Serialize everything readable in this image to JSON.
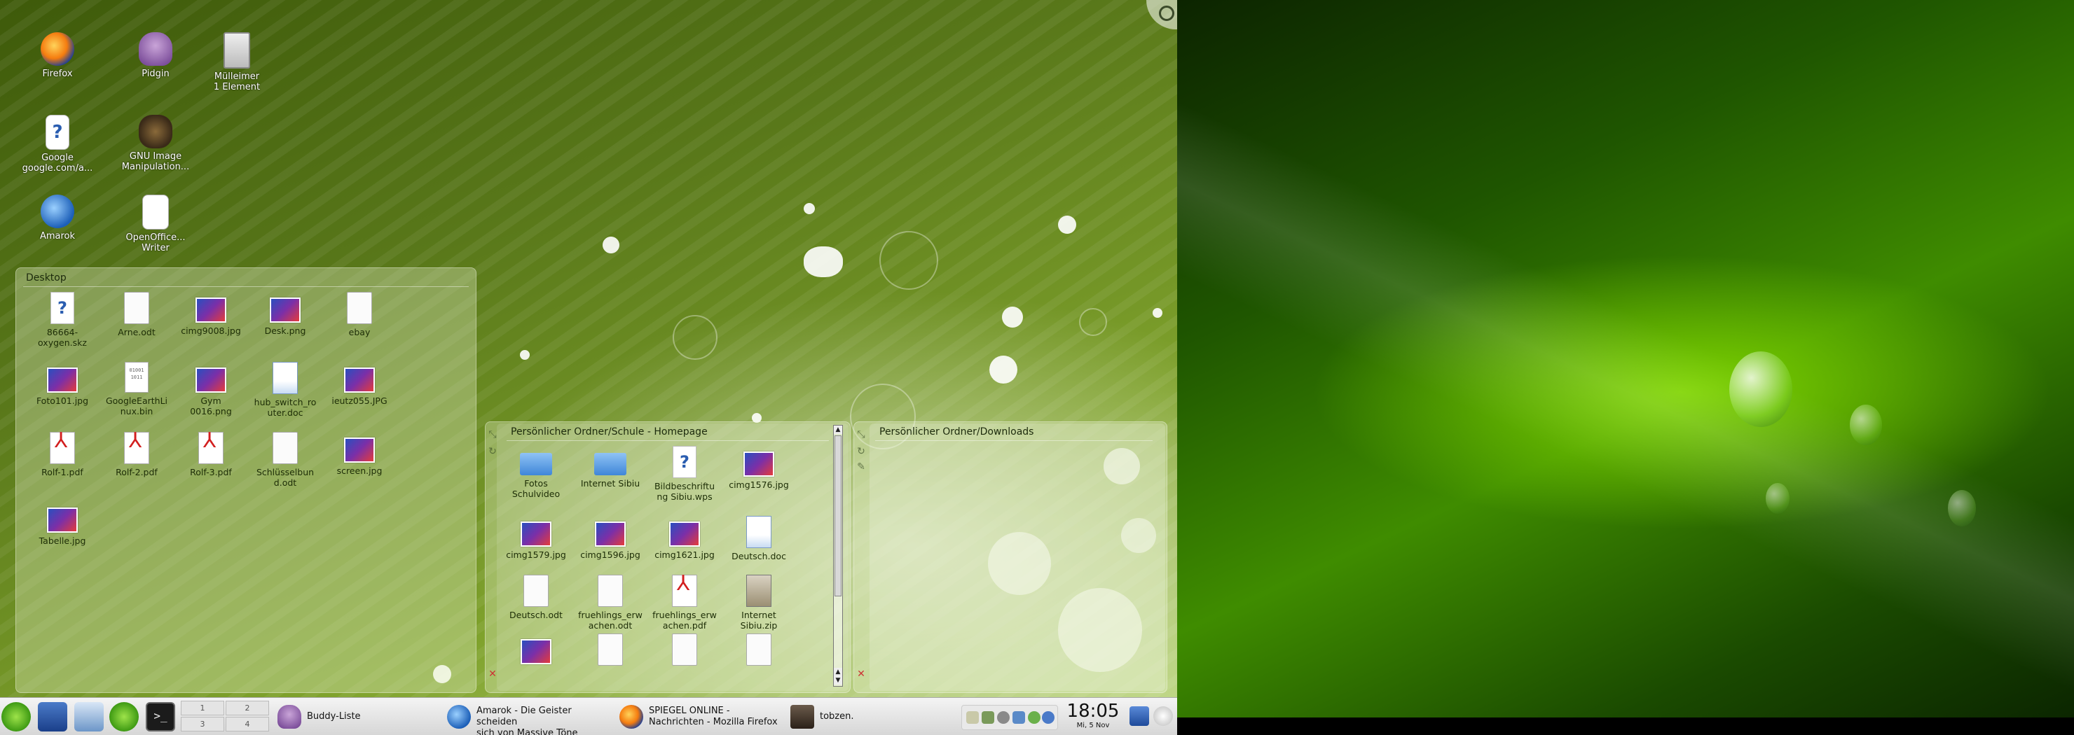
{
  "desktop_icons": {
    "firefox": "Firefox",
    "pidgin": "Pidgin",
    "trash": "Mülleimer\n1 Element",
    "google": "Google\ngoogle.com/a...",
    "gimp": "GNU Image\nManipulation...",
    "amarok": "Amarok",
    "openoffice": "OpenOffice...\nWriter"
  },
  "desktop_panel": {
    "title": "Desktop",
    "files": [
      {
        "label": "86664-\noxygen.skz",
        "kind": "unknown"
      },
      {
        "label": "Arne.odt",
        "kind": "doc"
      },
      {
        "label": "cimg9008.jpg",
        "kind": "image"
      },
      {
        "label": "Desk.png",
        "kind": "image"
      },
      {
        "label": "ebay",
        "kind": "doc"
      },
      {
        "label": "Foto101.jpg",
        "kind": "image"
      },
      {
        "label": "GoogleEarthLi\nnux.bin",
        "kind": "binary"
      },
      {
        "label": "Gym\n0016.png",
        "kind": "image"
      },
      {
        "label": "hub_switch_ro\nuter.doc",
        "kind": "word"
      },
      {
        "label": "ieutz055.JPG",
        "kind": "image"
      },
      {
        "label": "Rolf-1.pdf",
        "kind": "pdf"
      },
      {
        "label": "Rolf-2.pdf",
        "kind": "pdf"
      },
      {
        "label": "Rolf-3.pdf",
        "kind": "pdf"
      },
      {
        "label": "Schlüsselbun\nd.odt",
        "kind": "doc"
      },
      {
        "label": "screen.jpg",
        "kind": "image"
      },
      {
        "label": "Tabelle.jpg",
        "kind": "image"
      }
    ]
  },
  "homepage_panel": {
    "title": "Persönlicher Ordner/Schule - Homepage",
    "files": [
      {
        "label": "Fotos\nSchulvideo",
        "kind": "folder"
      },
      {
        "label": "Internet Sibiu",
        "kind": "folder"
      },
      {
        "label": "Bildbeschriftu\nng Sibiu.wps",
        "kind": "unknown"
      },
      {
        "label": "cimg1576.jpg",
        "kind": "image"
      },
      {
        "label": "cimg1579.jpg",
        "kind": "image"
      },
      {
        "label": "cimg1596.jpg",
        "kind": "image"
      },
      {
        "label": "cimg1621.jpg",
        "kind": "image"
      },
      {
        "label": "Deutsch.doc",
        "kind": "word"
      },
      {
        "label": "Deutsch.odt",
        "kind": "doc"
      },
      {
        "label": "fruehlings_erw\nachen.odt",
        "kind": "doc"
      },
      {
        "label": "fruehlings_erw\nachen.pdf",
        "kind": "pdf"
      },
      {
        "label": "Internet\nSibiu.zip",
        "kind": "zip"
      },
      {
        "label": "",
        "kind": "image"
      },
      {
        "label": "",
        "kind": "doc"
      },
      {
        "label": "",
        "kind": "doc"
      },
      {
        "label": "",
        "kind": "doc"
      }
    ]
  },
  "downloads_panel": {
    "title": "Persönlicher Ordner/Downloads"
  },
  "taskbar": {
    "pager": [
      "1",
      "2",
      "3",
      "4"
    ],
    "tasks": [
      {
        "label": "Buddy-Liste"
      },
      {
        "label": "Amarok - Die Geister scheiden\nsich von Massive Töne"
      },
      {
        "label": "SPIEGEL ONLINE -\nNachrichten - Mozilla Firefox"
      },
      {
        "label": "tobzen."
      }
    ],
    "clock_time": "18:05",
    "clock_date": "Mi, 5 Nov"
  },
  "colors": {
    "left_wallpaper": "#6f9420",
    "right_wallpaper": "#2f7a00",
    "taskbar": "#e2e2e2"
  }
}
